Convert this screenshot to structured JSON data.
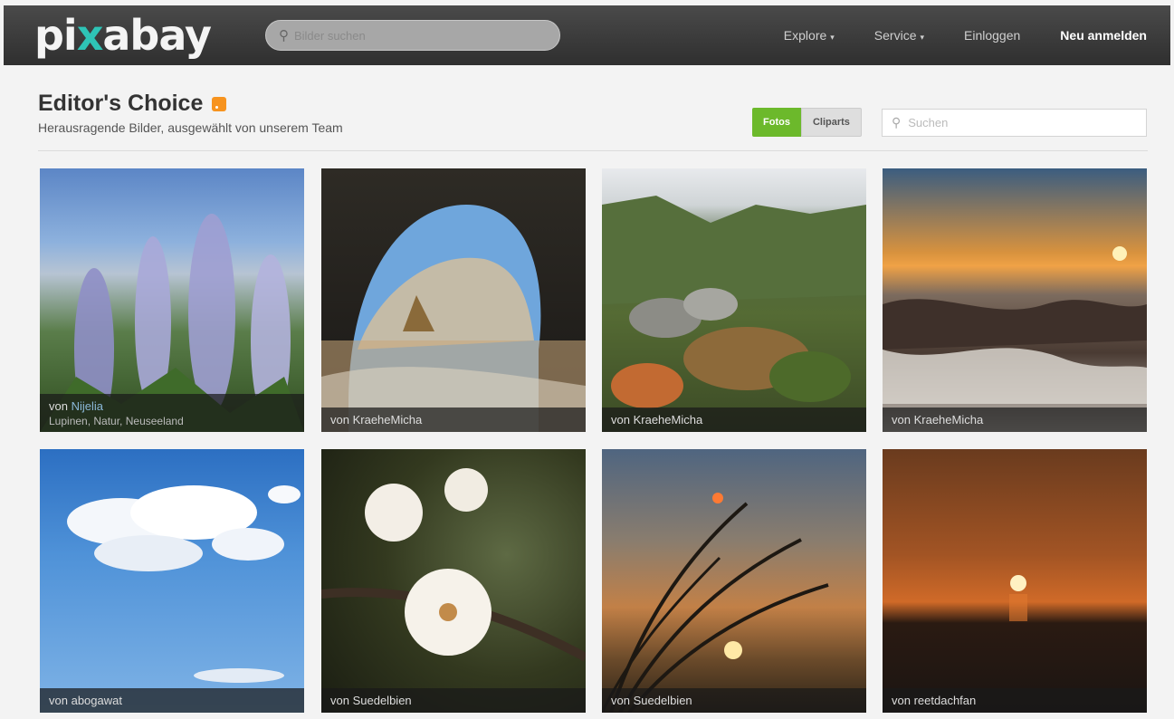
{
  "topbar": {
    "logo_pre": "pi",
    "logo_x": "x",
    "logo_post": "abay",
    "search_placeholder": "Bilder suchen",
    "nav": [
      {
        "label": "Explore",
        "caret": "▾"
      },
      {
        "label": "Service",
        "caret": "▾"
      },
      {
        "label": "Einloggen"
      },
      {
        "label": "Neu anmelden"
      }
    ]
  },
  "header": {
    "title": "Editor's Choice",
    "subtitle": "Herausragende Bilder, ausgewählt von unserem Team"
  },
  "filters": {
    "fotos": "Fotos",
    "cliparts": "Cliparts",
    "search_placeholder": "Suchen"
  },
  "colors": {
    "topbar": "#3a3a3a",
    "accent_green": "#6cb92b",
    "logo_x": "#2ec4b6"
  },
  "images": [
    {
      "prefix": "von",
      "author": "Nijelia",
      "tags": "Lupinen, Natur, Neuseeland"
    },
    {
      "prefix": "von",
      "author": "KraeheMicha"
    },
    {
      "prefix": "von",
      "author": "KraeheMicha"
    },
    {
      "prefix": "von",
      "author": "KraeheMicha"
    },
    {
      "prefix": "von",
      "author": "abogawat"
    },
    {
      "prefix": "von",
      "author": "Suedelbien"
    },
    {
      "prefix": "von",
      "author": "Suedelbien"
    },
    {
      "prefix": "von",
      "author": "reetdachfan"
    }
  ]
}
